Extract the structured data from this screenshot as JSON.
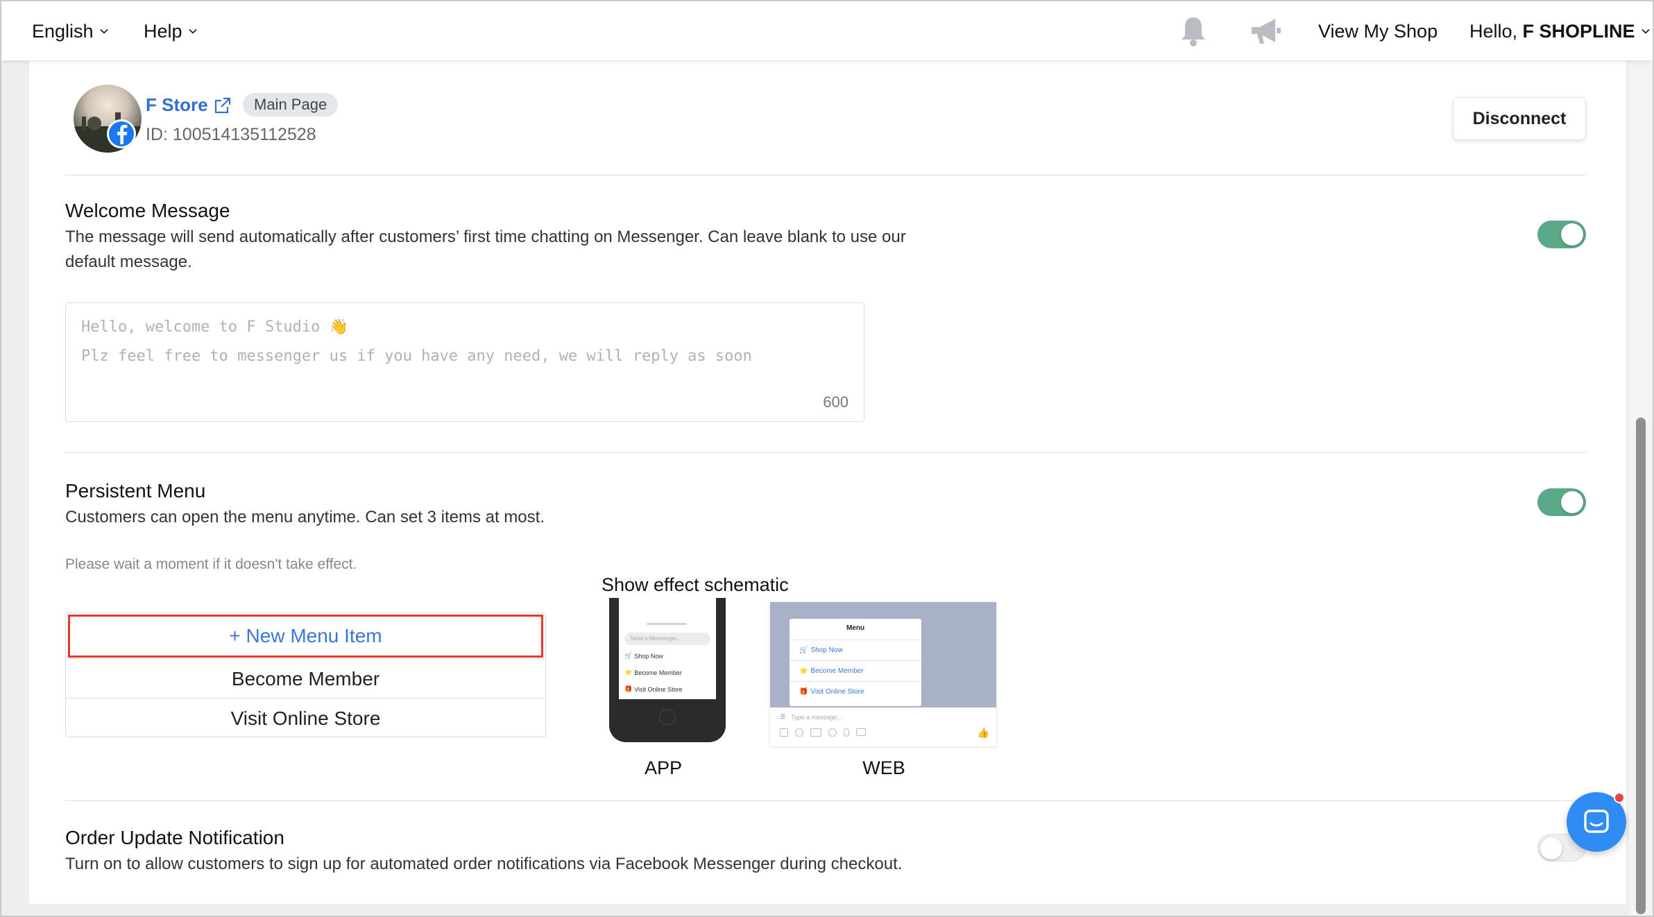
{
  "topbar": {
    "language": "English",
    "help": "Help",
    "view_shop": "View My Shop",
    "greeting_prefix": "Hello,",
    "greeting_name": "F SHOPLINE"
  },
  "page": {
    "store_name": "F Store",
    "page_badge": "Main Page",
    "page_id": "ID: 100514135112528",
    "disconnect_label": "Disconnect"
  },
  "welcome": {
    "title": "Welcome Message",
    "description_line1": "The message will send automatically after customers’ first time chatting on Messenger. Can leave blank to use our",
    "description_line2": "default message.",
    "enabled": true,
    "message_line1": "Hello, welcome to F Studio 👋",
    "message_line2": "Plz feel free to messenger us if you have any need, we will reply as soon",
    "char_count": "600"
  },
  "persistent_menu": {
    "title": "Persistent Menu",
    "description": "Customers can open the menu anytime. Can set 3 items at most.",
    "enabled": true,
    "note": "Please wait a moment if it doesn't take effect.",
    "new_item_label": "+ New Menu Item",
    "items": [
      "Become Member",
      "Visit Online Store"
    ],
    "schematic_title": "Show effect schematic",
    "app_label": "APP",
    "web_label": "WEB",
    "app_preview": {
      "input_placeholder": "Send a Messenger...",
      "items": [
        "Shop Now",
        "Become Member",
        "Visit Online Store"
      ]
    },
    "web_preview": {
      "menu_title": "Menu",
      "items": [
        "Shop Now",
        "Become Member",
        "Visit Online Store"
      ],
      "input_placeholder": "Type a message..."
    }
  },
  "order_update": {
    "title": "Order Update Notification",
    "description": "Turn on to allow customers to sign up for automated order notifications via Facebook Messenger during checkout.",
    "enabled": false
  },
  "colors": {
    "toggle_on": "#5aa886",
    "link_blue": "#2f6fd6",
    "highlight_red": "#e43a2b",
    "facebook_blue": "#1877f2",
    "launcher_blue": "#2f8cf5"
  }
}
